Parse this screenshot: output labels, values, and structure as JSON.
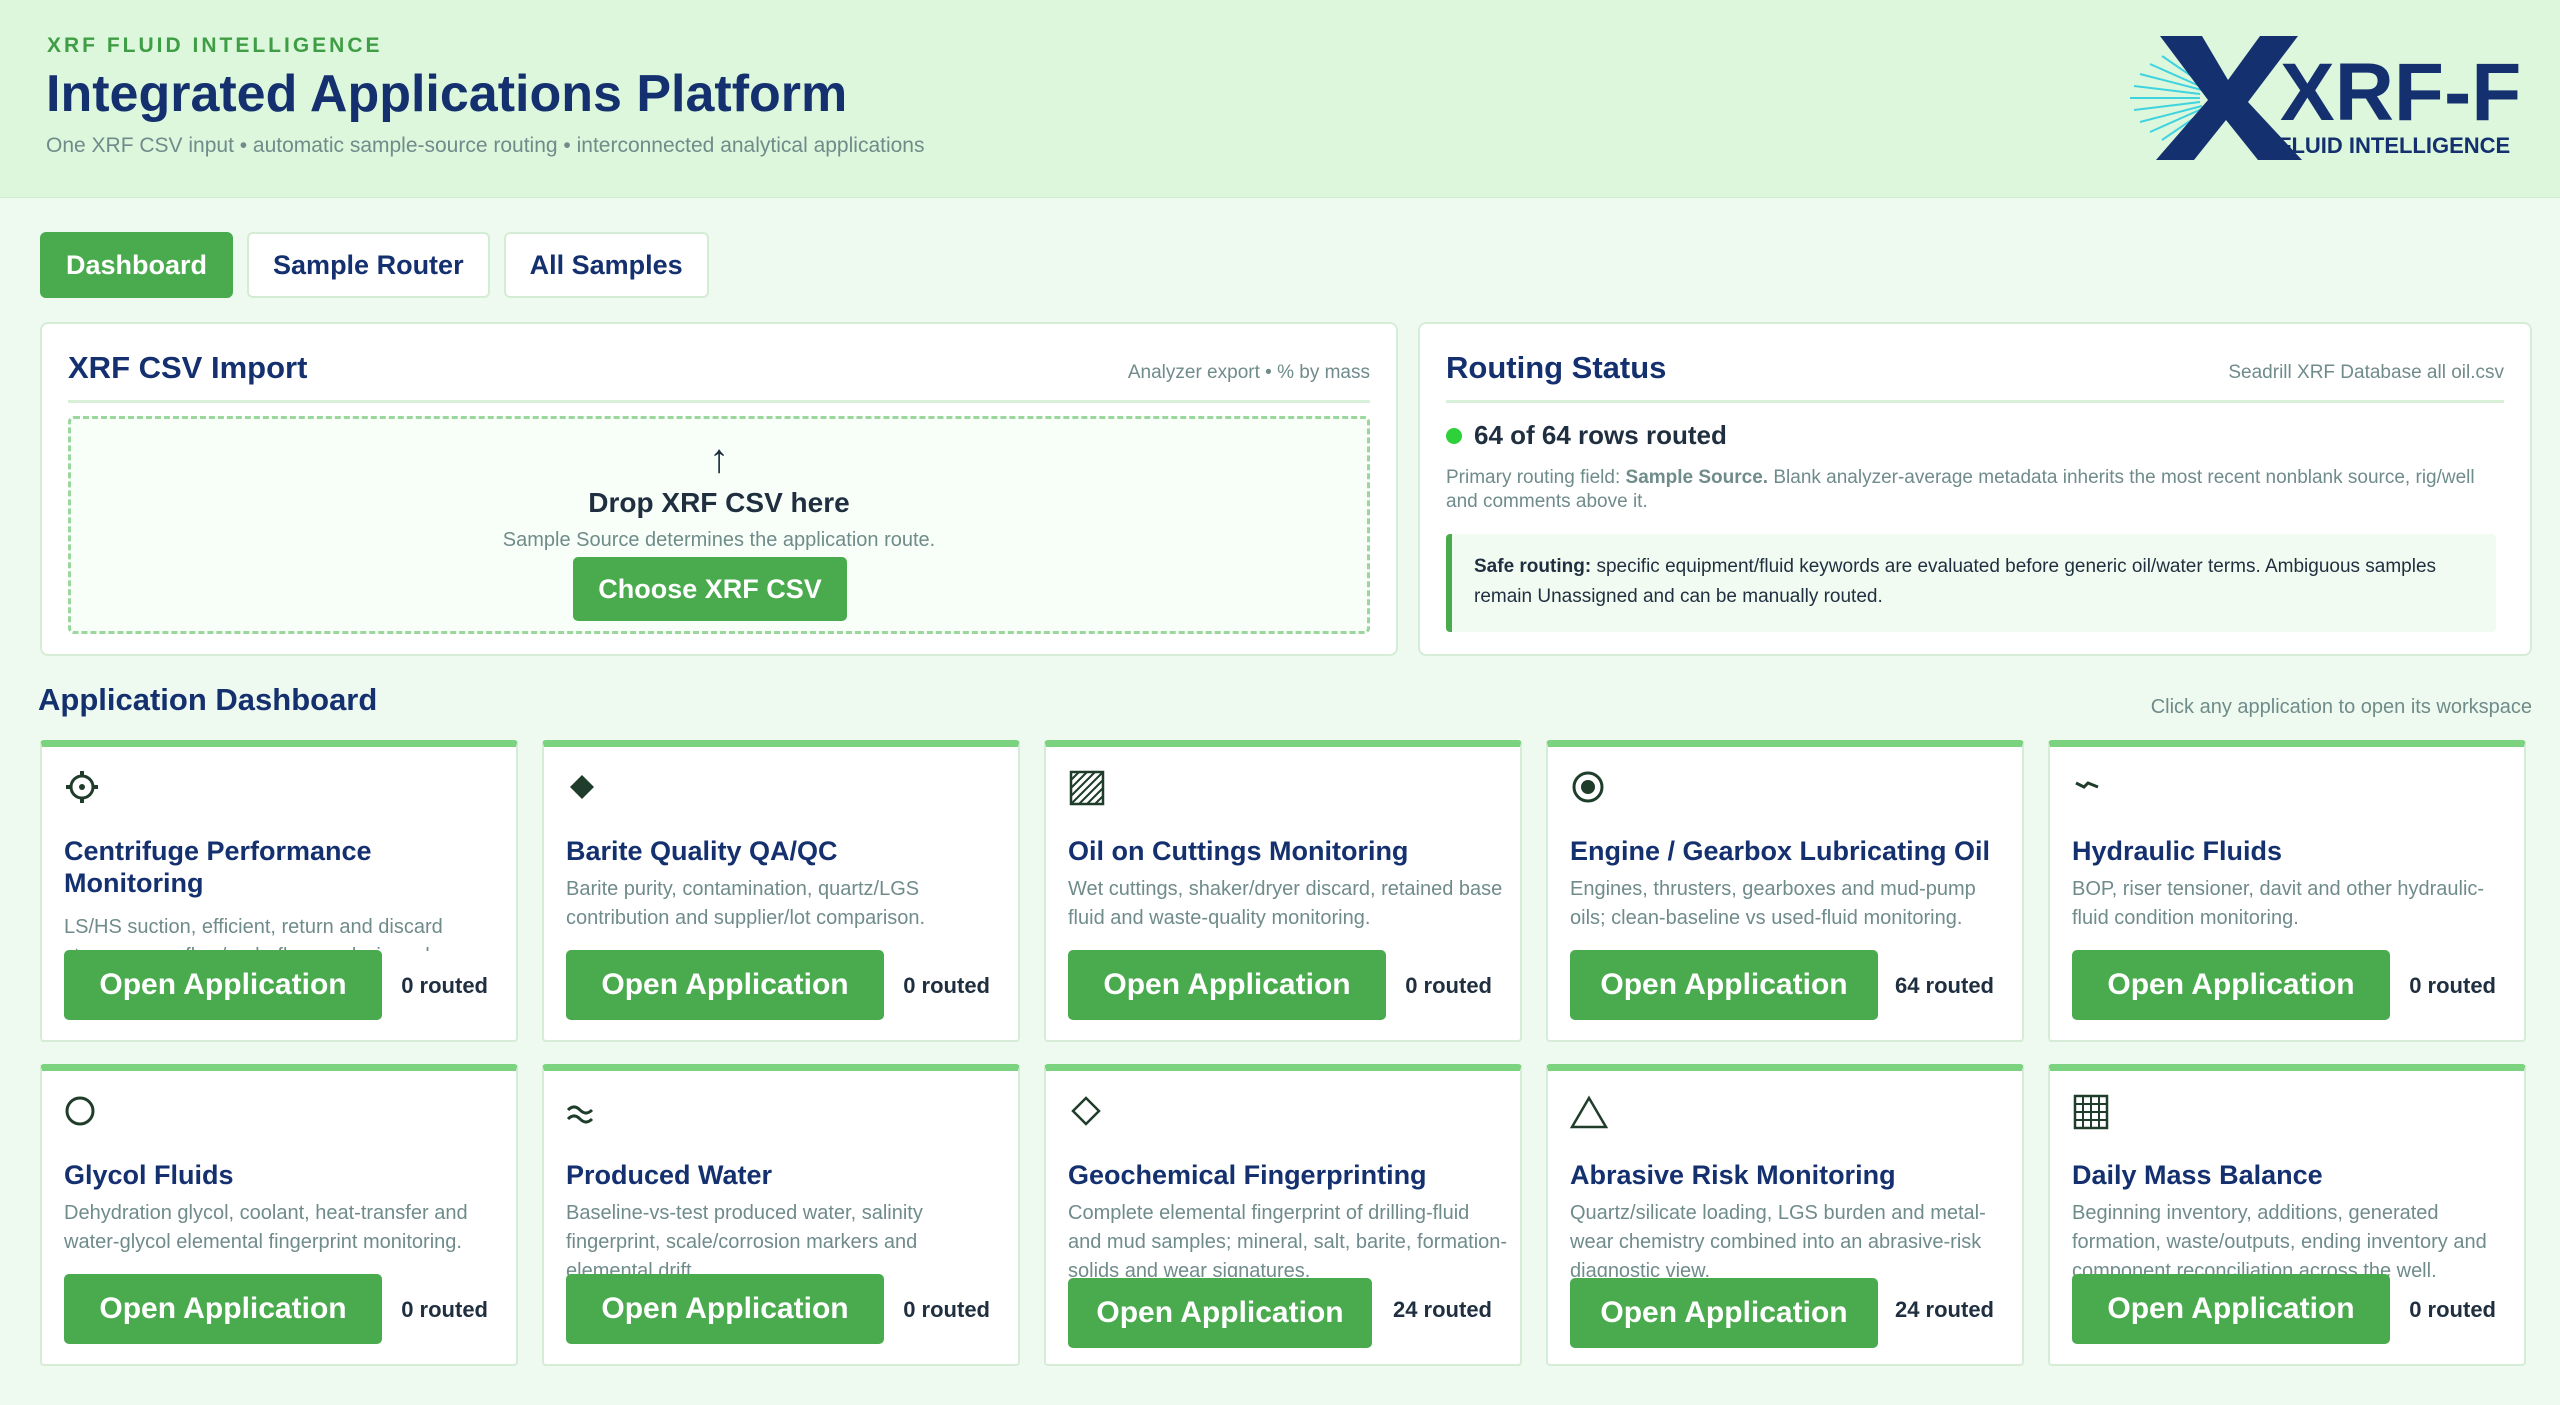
{
  "header": {
    "eyebrow": "XRF FLUID INTELLIGENCE",
    "title": "Integrated Applications Platform",
    "subtitle": "One XRF CSV input • automatic sample-source routing • interconnected analytical applications",
    "logo_main": "XRF-FI",
    "logo_sub": "FLUID INTELLIGENCE"
  },
  "tabs": [
    {
      "label": "Dashboard",
      "active": true
    },
    {
      "label": "Sample Router",
      "active": false
    },
    {
      "label": "All Samples",
      "active": false
    }
  ],
  "import_panel": {
    "title": "XRF CSV Import",
    "meta": "Analyzer export • % by mass",
    "arrow": "↑",
    "drop_title": "Drop XRF CSV here",
    "drop_sub": "Sample Source determines the application route.",
    "button": "Choose XRF CSV"
  },
  "routing_panel": {
    "title": "Routing Status",
    "meta": "Seadrill XRF Database all oil.csv",
    "status": "64 of 64 rows routed",
    "primary_prefix": "Primary routing field: ",
    "primary_field": "Sample Source.",
    "primary_rest": " Blank analyzer-average metadata inherits the most recent nonblank source, rig/well and comments above it.",
    "safe_label": "Safe routing:",
    "safe_text": " specific equipment/fluid keywords are evaluated before generic oil/water terms. Ambiguous samples remain Unassigned and can be manually routed."
  },
  "dashboard": {
    "title": "Application Dashboard",
    "hint": "Click any application to open its workspace",
    "open_label": "Open Application",
    "apps": [
      {
        "icon": "gear-icon",
        "title": "Centrifuge Performance Monitoring",
        "desc": "LS/HS suction, efficient, return and discard streams; overflow/underflow analysis and",
        "routed": "0 routed"
      },
      {
        "icon": "diamond-filled-icon",
        "title": "Barite Quality QA/QC",
        "desc": "Barite purity, contamination, quartz/LGS contribution and supplier/lot comparison.",
        "routed": "0 routed"
      },
      {
        "icon": "hatched-square-icon",
        "title": "Oil on Cuttings Monitoring",
        "desc": "Wet cuttings, shaker/dryer discard, retained base fluid and waste-quality monitoring.",
        "routed": "0 routed"
      },
      {
        "icon": "target-icon",
        "title": "Engine / Gearbox Lubricating Oil",
        "desc": "Engines, thrusters, gearboxes and mud-pump oils; clean-baseline vs used-fluid monitoring.",
        "routed": "64 routed"
      },
      {
        "icon": "hydraulic-icon",
        "title": "Hydraulic Fluids",
        "desc": "BOP, riser tensioner, davit and other hydraulic-fluid condition monitoring.",
        "routed": "0 routed"
      },
      {
        "icon": "circle-icon",
        "title": "Glycol Fluids",
        "desc": "Dehydration glycol, coolant, heat-transfer and water-glycol elemental fingerprint monitoring.",
        "routed": "0 routed"
      },
      {
        "icon": "approx-icon",
        "title": "Produced Water",
        "desc": "Baseline-vs-test produced water, salinity fingerprint, scale/corrosion markers and elemental drift.",
        "routed": "0 routed"
      },
      {
        "icon": "diamond-outline-icon",
        "title": "Geochemical Fingerprinting",
        "desc": "Complete elemental fingerprint of drilling-fluid and mud samples; mineral, salt, barite, formation-solids and wear signatures.",
        "routed": "24 routed"
      },
      {
        "icon": "triangle-icon",
        "title": "Abrasive Risk Monitoring",
        "desc": "Quartz/silicate loading, LGS burden and metal-wear chemistry combined into an abrasive-risk diagnostic view.",
        "routed": "24 routed"
      },
      {
        "icon": "grid-icon",
        "title": "Daily Mass Balance",
        "desc": "Beginning inventory, additions, generated formation, waste/outputs, ending inventory and component reconciliation across the well.",
        "routed": "0 routed"
      }
    ]
  },
  "colors": {
    "accent": "#4aab4e",
    "navy": "#14306f",
    "header_bg": "#dcf7dc",
    "page_bg": "#eefaef"
  }
}
